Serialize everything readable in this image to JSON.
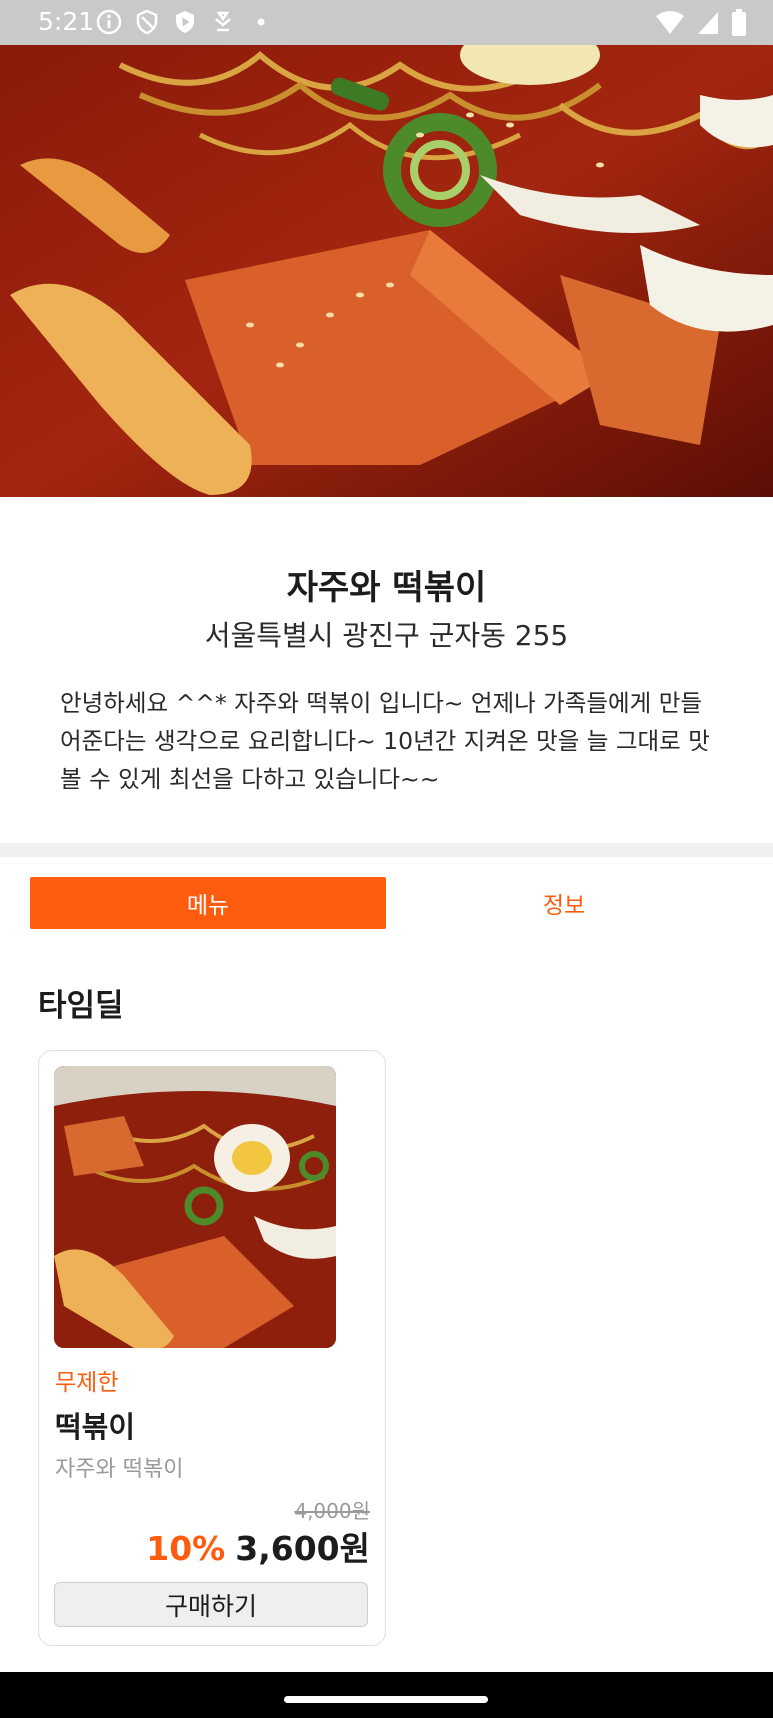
{
  "status_bar": {
    "time": "5:21",
    "left_icons": [
      "info-icon",
      "shield-icon",
      "play-protect-icon",
      "download-icon",
      "dot-icon"
    ],
    "right_icons": [
      "wifi-icon",
      "signal-icon",
      "battery-icon"
    ]
  },
  "store": {
    "name": "자주와 떡볶이",
    "address": "서울특별시 광진구 군자동 255",
    "description": "안녕하세요 ^^* 자주와 떡볶이 입니다~ 언제나 가족들에게 만들어준다는 생각으로 요리합니다~ 10년간 지켜온 맛을 늘 그대로 맛볼 수 있게 최선을 다하고 있습니다~~"
  },
  "tabs": [
    {
      "label": "메뉴",
      "active": true
    },
    {
      "label": "정보",
      "active": false
    }
  ],
  "section": {
    "title": "타임딜"
  },
  "product": {
    "badge": "무제한",
    "name": "떡볶이",
    "store": "자주와 떡볶이",
    "original_price": "4,000원",
    "discount": "10%",
    "price": "3,600원",
    "buy_label": "구매하기"
  },
  "colors": {
    "accent": "#ff5c0f",
    "status_bar": "#c9c9c9",
    "divider": "#f0f0f0"
  }
}
